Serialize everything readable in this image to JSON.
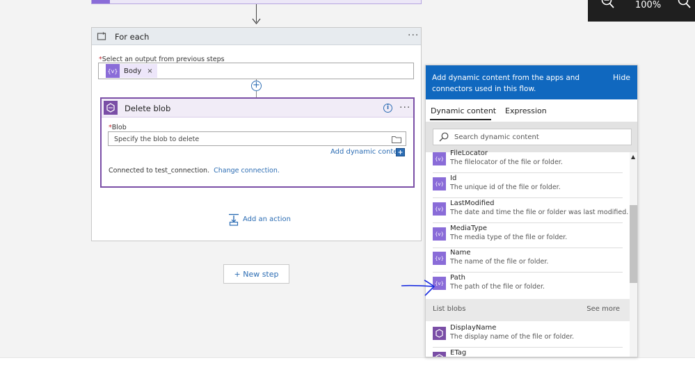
{
  "toolbar": {
    "zoom_label": "100%"
  },
  "foreach": {
    "title": "For each",
    "menu": "···",
    "output_label": "Select an output from previous steps",
    "token_label": "Body",
    "token_icon": "{v}",
    "token_close": "×"
  },
  "delete_blob": {
    "title": "Delete blob",
    "menu": "···",
    "blob_label": "Blob",
    "blob_placeholder": "Specify the blob to delete",
    "add_dynamic": "Add dynamic content",
    "connected_text": "Connected to test_connection.",
    "change_connection": "Change connection."
  },
  "add_action": "Add an action",
  "new_step": "+ New step",
  "dynamic_panel": {
    "header_text": "Add dynamic content from the apps and connectors used in this flow.",
    "hide": "Hide",
    "tabs": [
      "Dynamic content",
      "Expression"
    ],
    "search_placeholder": "Search dynamic content",
    "items": [
      {
        "name": "FileLocator",
        "desc": "The filelocator of the file or folder.",
        "icon": "{v}"
      },
      {
        "name": "Id",
        "desc": "The unique id of the file or folder.",
        "icon": "{v}"
      },
      {
        "name": "LastModified",
        "desc": "The date and time the file or folder was last modified.",
        "icon": "{v}"
      },
      {
        "name": "MediaType",
        "desc": "The media type of the file or folder.",
        "icon": "{v}"
      },
      {
        "name": "Name",
        "desc": "The name of the file or folder.",
        "icon": "{v}"
      },
      {
        "name": "Path",
        "desc": "The path of the file or folder.",
        "icon": "{v}"
      }
    ],
    "section": {
      "name": "List blobs",
      "see_more": "See more"
    },
    "section_items": [
      {
        "name": "DisplayName",
        "desc": "The display name of the file or folder."
      },
      {
        "name": "ETag",
        "desc": ""
      }
    ]
  },
  "colors": {
    "accent_blue": "#1068bf",
    "link_blue": "#2b6cb3",
    "dynamic_purple": "#8a6cd8",
    "blob_purple": "#7a4ea6"
  }
}
